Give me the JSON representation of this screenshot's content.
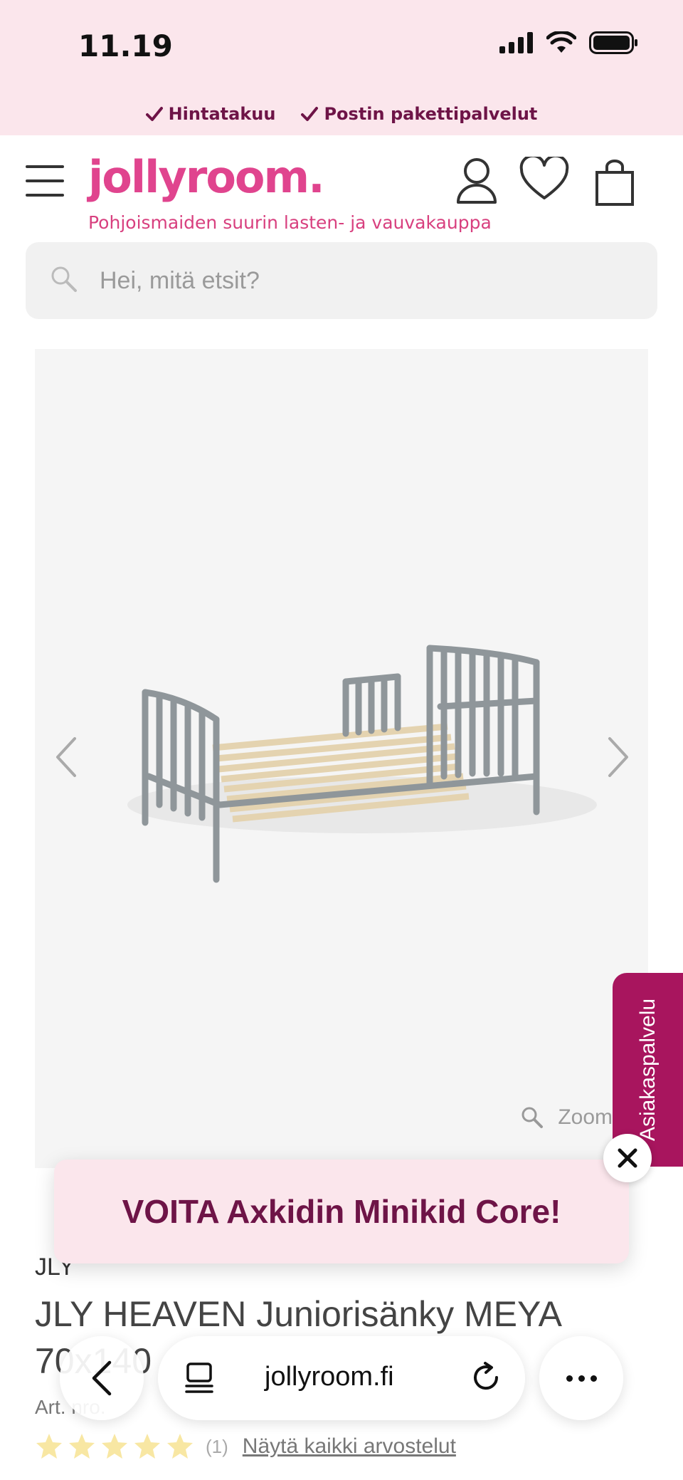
{
  "status_bar": {
    "time": "11.19"
  },
  "usp": [
    {
      "label": "Hintatakuu"
    },
    {
      "label": "Postin pakettipalvelut"
    }
  ],
  "header": {
    "logo": "jollyroom.",
    "tagline": "Pohjoismaiden suurin lasten- ja vauvakauppa"
  },
  "search": {
    "placeholder": "Hei, mitä etsit?"
  },
  "gallery": {
    "zoom_label": "Zoom"
  },
  "side_tab": {
    "label": "Asiakaspalvelu"
  },
  "promo": {
    "text": "VOITA Axkidin Minikid Core!"
  },
  "product": {
    "brand": "JLY",
    "title": "JLY HEAVEN Juniorisänky MEYA 70x140",
    "art_label": "Art. nro.",
    "review_count": "(1)",
    "reviews_link": "Näytä kaikki arvostelut",
    "rating": 5
  },
  "browser": {
    "url": "jollyroom.fi"
  },
  "colors": {
    "brand_pink": "#e0448e",
    "plum": "#6e1447",
    "tab_magenta": "#a8155e",
    "star": "#f5c518"
  }
}
